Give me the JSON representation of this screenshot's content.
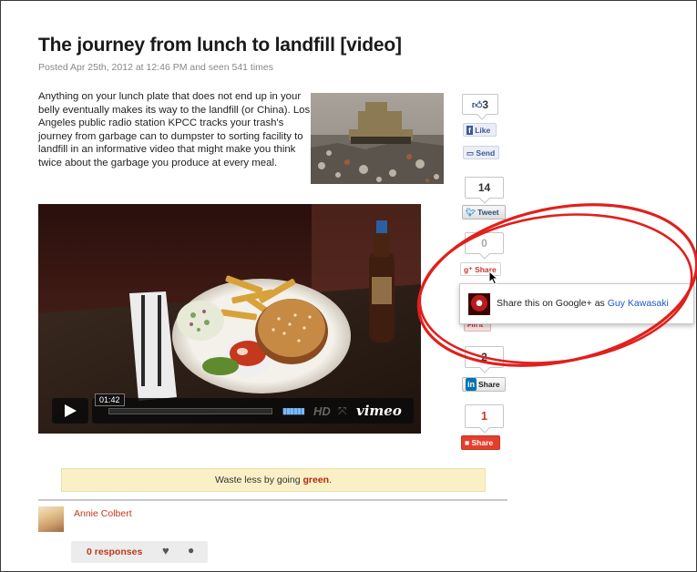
{
  "article": {
    "title": "The journey from lunch to landfill [video]",
    "meta": "Posted Apr 25th, 2012 at 12:46 PM and seen 541 times",
    "body": "Anything on your lunch plate that does not end up in your belly eventually makes its way to the landfill (or China). Los Angeles public radio station KPCC tracks your trash's journey from garbage can to dumpster to sorting facility to landfill in an informative video that might make you think twice about the garbage you produce at every meal."
  },
  "video": {
    "time": "01:42",
    "hd": "HD",
    "brand": "vimeo"
  },
  "cta": {
    "prefix": "Waste less by going ",
    "highlight": "green",
    "suffix": "."
  },
  "author": {
    "name": "Annie Colbert"
  },
  "responses": {
    "label": "0 responses"
  },
  "share": {
    "facebook": {
      "count": "3",
      "like": "Like",
      "send": "Send"
    },
    "twitter": {
      "count": "14",
      "label": "Tweet"
    },
    "google": {
      "count": "0",
      "label": "Share"
    },
    "pinterest": {
      "label": "Pin it"
    },
    "linkedin": {
      "count": "2",
      "logo": "in",
      "label": "Share"
    },
    "reddit": {
      "count": "1",
      "label": "Share"
    }
  },
  "popup": {
    "text": "Share this on Google+ as ",
    "user": "Guy Kawasaki"
  },
  "colors": {
    "accent_red": "#c0391b",
    "annotation_red": "#e0201c",
    "facebook_blue": "#3b5998",
    "twitter_blue": "#2b8ed8",
    "linkedin_blue": "#0073b2",
    "cta_bg": "#faf0c6"
  },
  "icons": {
    "thumbs_up": "thumbs-up-icon",
    "facebook": "facebook-logo-icon",
    "send": "send-icon",
    "twitter": "twitter-bird-icon",
    "google_plus": "google-plus-icon",
    "reddit": "reddit-icon",
    "heart": "heart-icon",
    "comment": "comment-icon",
    "play": "play-icon",
    "cursor": "cursor-icon"
  }
}
